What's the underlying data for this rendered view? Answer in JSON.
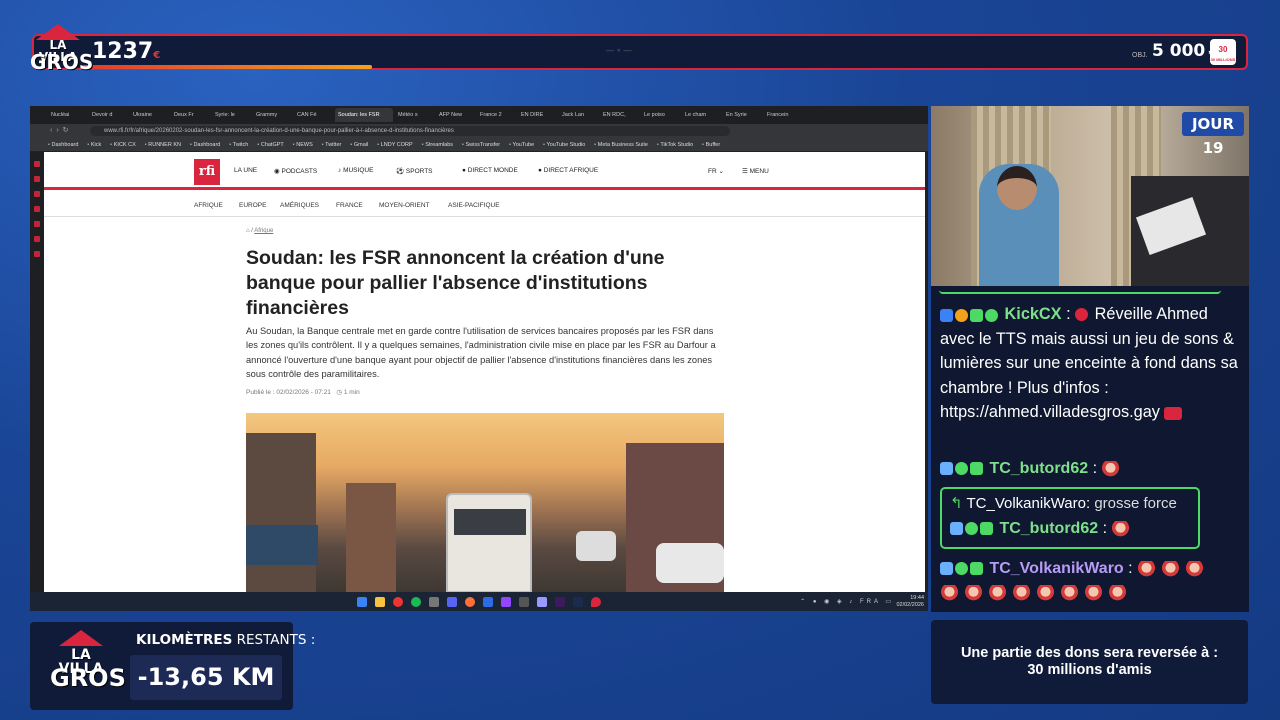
{
  "overlay": {
    "brand_line1": "LA VILLA",
    "brand_line2": "GROS",
    "top_count": "1237",
    "top_count_unit": "€",
    "goal_label": "OBJ.",
    "goal_value": "5 000",
    "goal_unit": "€",
    "goal_badge": "30 MILLIONS",
    "day_badge": "JOUR 19",
    "km_label_bold": "KILOMÈTRES",
    "km_label_rest": " RESTANTS :",
    "km_value": "-13,65 KM",
    "donation_line1": "Une partie des dons sera reversée à :",
    "donation_line2": "30 millions d'amis"
  },
  "browser": {
    "tabs": [
      "Nucléai",
      "Devoir d",
      "Ukraine",
      "Deux Fr",
      "Syrie: le",
      "Grammy",
      "CAN Fé",
      "Soudan: les FSR",
      "Météo s",
      "AFP New",
      "France 2",
      "EN DIRE",
      "Jack Lan",
      "EN RDC,",
      "Le poiso",
      "Le cham",
      "En Syrie",
      "Francein"
    ],
    "active_tab_index": 7,
    "url": "www.rfi.fr/fr/afrique/20260202-soudan-les-fsr-annoncent-la-création-d-une-banque-pour-pallier-à-l-absence-d-institutions-financières",
    "bookmarks": [
      "Dashboard",
      "Kick",
      "KICK CX",
      "RUNNER KN",
      "Dashboard",
      "Twitch",
      "ChatGPT",
      "NEWS",
      "Twitter",
      "Gmail",
      "LNDY CORP",
      "Streamlabs",
      "SwissTransfer",
      "YouTube",
      "YouTube Studio",
      "Meta Business Suite",
      "TikTok Studio",
      "Buffer"
    ],
    "clock_time": "19:44",
    "clock_date": "02/02/2026",
    "tray_lang": "FRA"
  },
  "rfi": {
    "logo": "rfi",
    "nav": [
      "LA UNE",
      "PODCASTS",
      "MUSIQUE",
      "SPORTS",
      "DIRECT MONDE",
      "DIRECT AFRIQUE"
    ],
    "lang": "FR",
    "menu": "MENU",
    "subnav": [
      "AFRIQUE",
      "EUROPE",
      "AMÉRIQUES",
      "FRANCE",
      "MOYEN-ORIENT",
      "ASIE-PACIFIQUE"
    ],
    "breadcrumb": "Afrique",
    "headline": "Soudan: les FSR annoncent la création d'une banque pour pallier l'absence d'institutions financières",
    "lead": "Au Soudan, la Banque centrale met en garde contre l'utilisation de services bancaires proposés par les FSR dans les zones qu'ils contrôlent. Il y a quelques semaines, l'administration civile mise en place par les FSR au Darfour a annoncé l'ouverture d'une banque ayant pour objectif de pallier l'absence d'institutions financières dans les zones sous contrôle des paramilitaires.",
    "published": "Publié le : 02/02/2026 - 07:21",
    "read_time": "1 min"
  },
  "chat": {
    "msg1_user": "KickCX",
    "msg1_text": "Réveille Ahmed avec le TTS mais aussi un jeu de sons & lumières sur une enceinte à fond dans sa chambre ! Plus d'infos : https://ahmed.villadesgros.gay",
    "msg2_user": "TC_butord62",
    "reply_user": "TC_VolkanikWaro:",
    "reply_text": "grosse force",
    "reply_msg_user": "TC_butord62",
    "msg3_user": "TC_VolkanikWaro",
    "sep": ":"
  }
}
